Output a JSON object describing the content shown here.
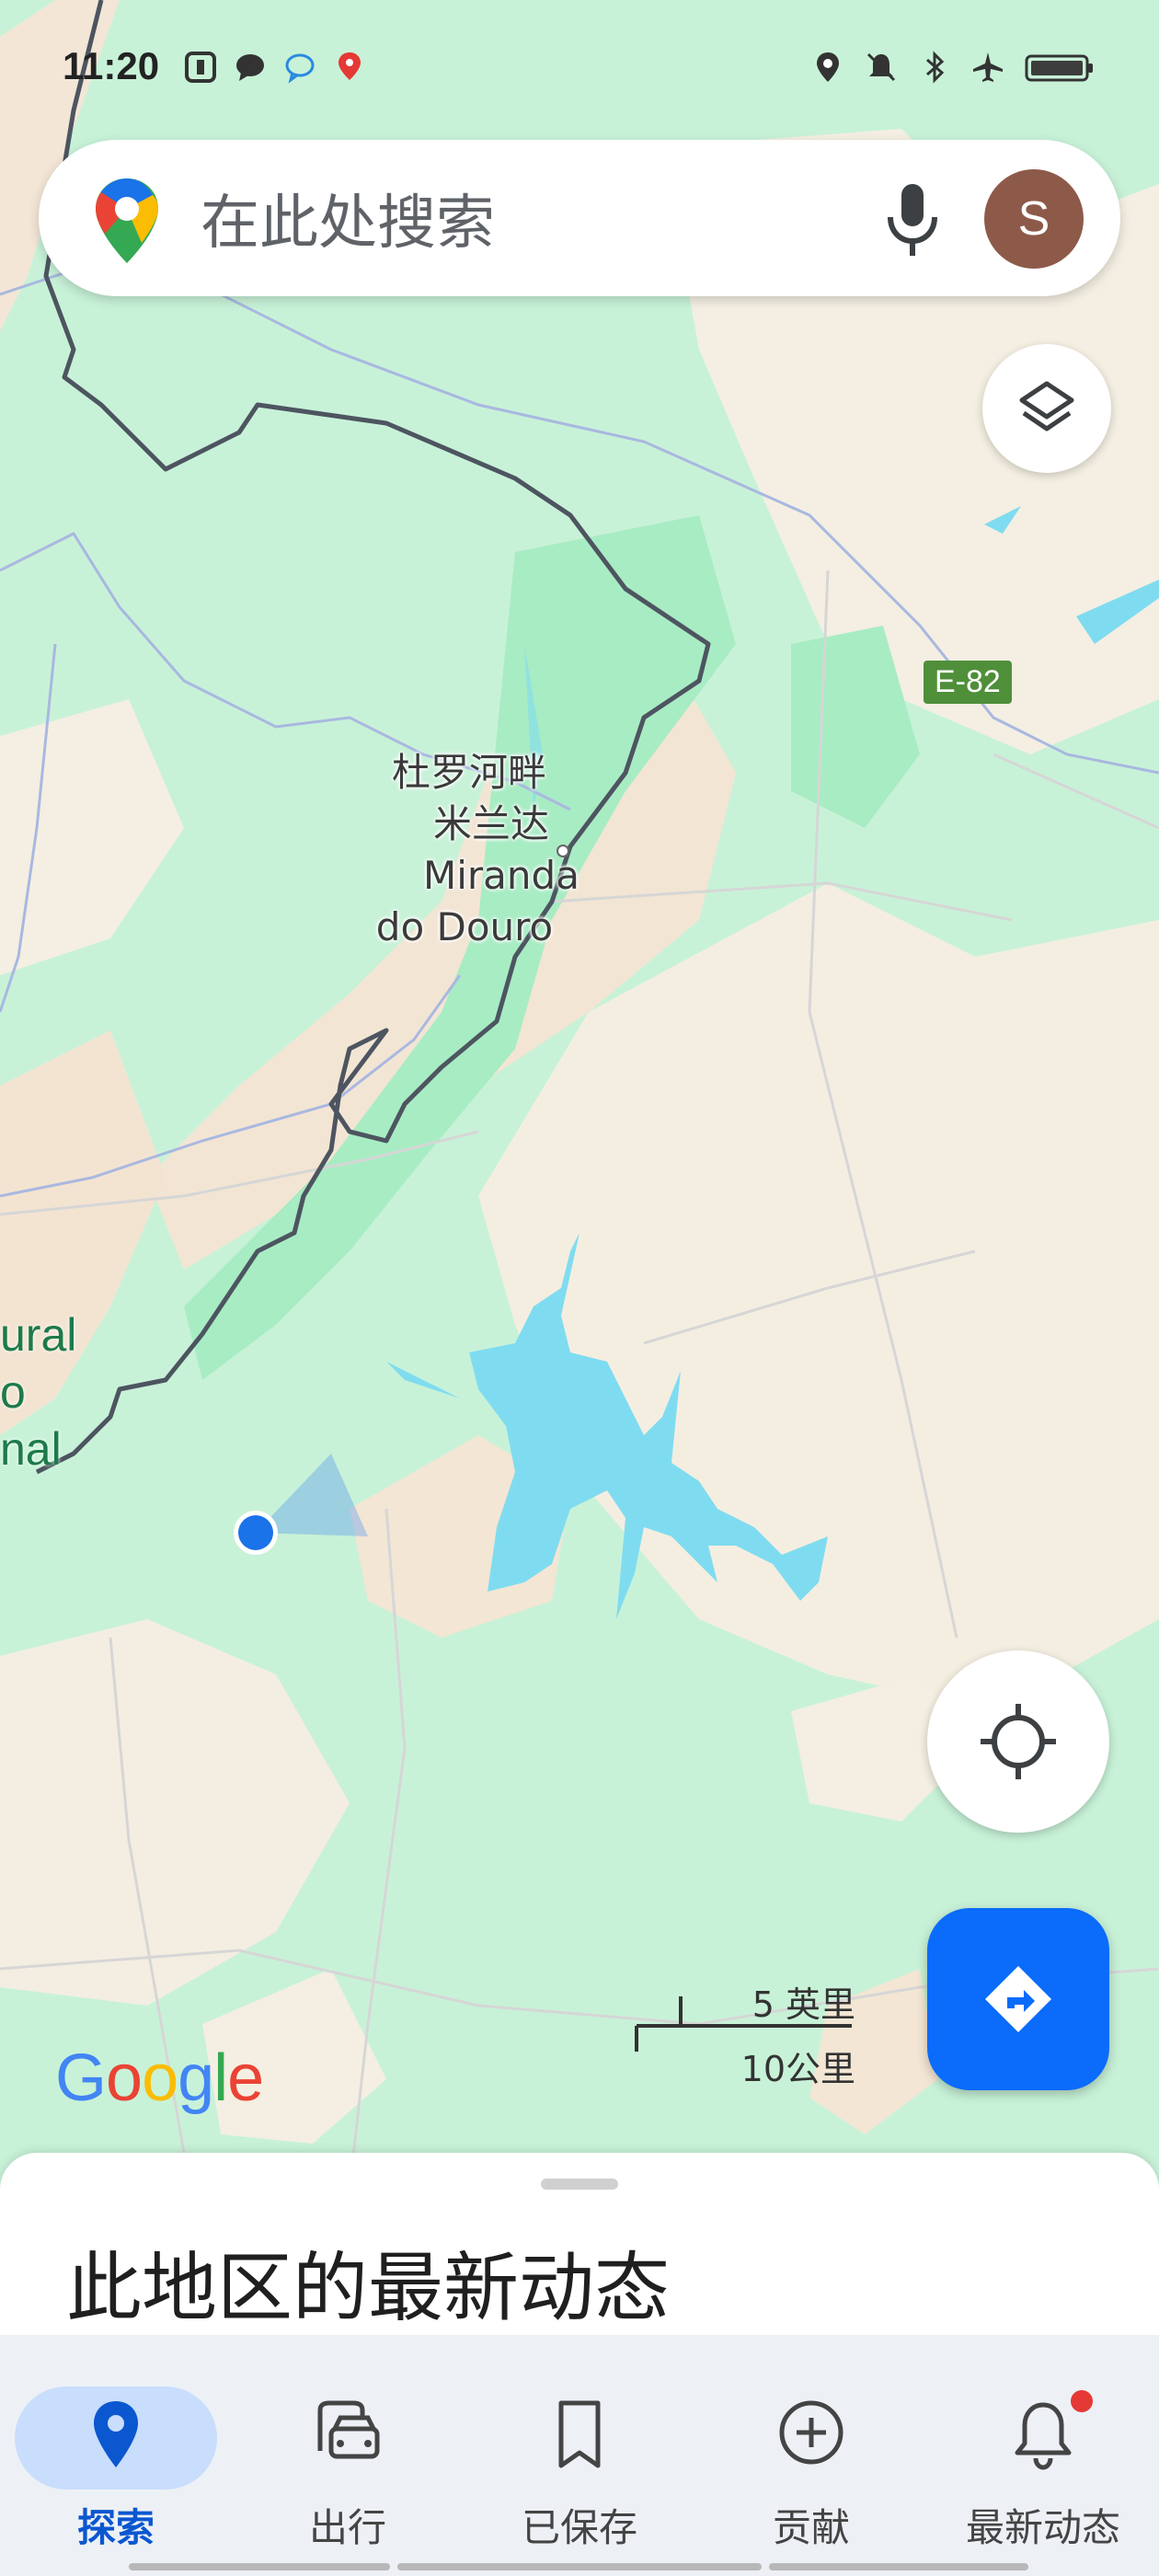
{
  "status_bar": {
    "time": "11:20",
    "left_icons": [
      "notification-icon",
      "chat-icon",
      "message-icon",
      "map-pin-icon"
    ],
    "right_icons": [
      "location-icon",
      "mute-icon",
      "bluetooth-icon",
      "airplane-icon",
      "battery-icon"
    ]
  },
  "search": {
    "placeholder": "在此处搜索",
    "avatar_letter": "S"
  },
  "map": {
    "place_label_cn_line1": "杜罗河畔",
    "place_label_cn_line2": "米兰达",
    "place_label_en_line1": "Miranda",
    "place_label_en_line2": "do Douro",
    "road_shield": "E-82",
    "side_label_line1": "ural",
    "side_label_line2": "o",
    "side_label_line3": "nal",
    "scale_top": "5 英里",
    "scale_bottom": "10公里",
    "logo": "Google"
  },
  "sheet": {
    "title": "此地区的最新动态"
  },
  "nav": {
    "items": [
      {
        "label": "探索",
        "icon": "explore-pin-icon",
        "active": true
      },
      {
        "label": "出行",
        "icon": "commute-car-icon",
        "active": false
      },
      {
        "label": "已保存",
        "icon": "bookmark-icon",
        "active": false
      },
      {
        "label": "贡献",
        "icon": "add-circle-icon",
        "active": false
      },
      {
        "label": "最新动态",
        "icon": "bell-icon",
        "active": false
      }
    ]
  },
  "colors": {
    "accent": "#0b6bfa",
    "water": "#7fdcf0",
    "forest": "#b9f0cf",
    "land": "#f2e8d8"
  }
}
